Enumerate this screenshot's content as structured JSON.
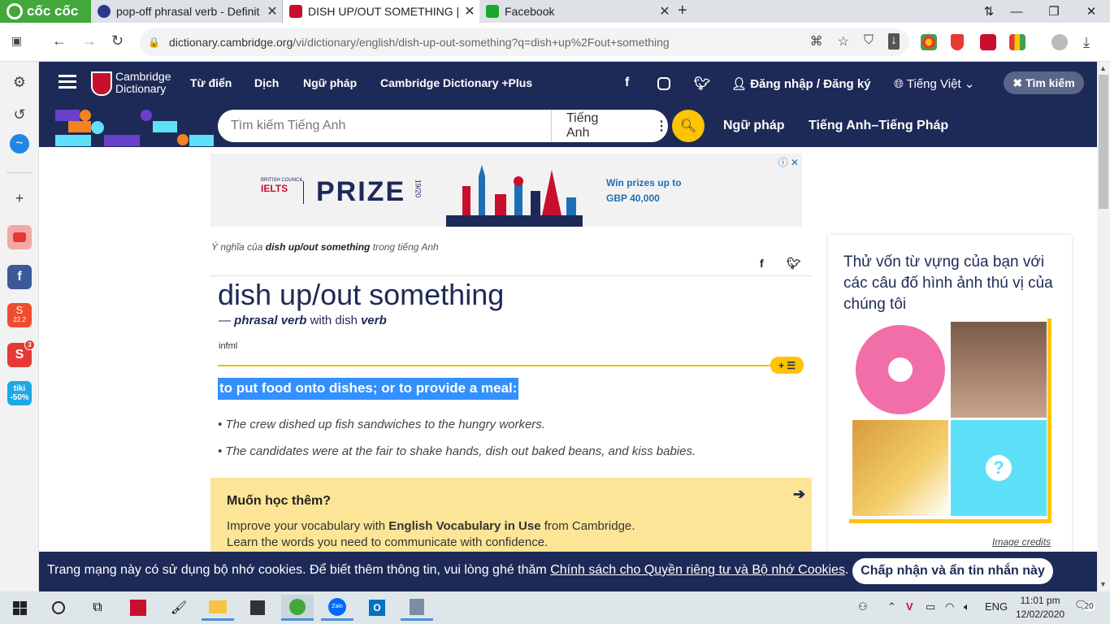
{
  "browser": {
    "brand": "cốc cốc",
    "tabs": [
      {
        "title": "pop-off phrasal verb - Definit",
        "favicon": "oxford-icon",
        "color": "#2b3a8c"
      },
      {
        "title": "DISH UP/OUT SOMETHING | n",
        "favicon": "cambridge-icon",
        "color": "#c8102e"
      },
      {
        "title": "Facebook",
        "favicon": "facebook-green-icon",
        "color": "#19a92e"
      }
    ],
    "close_glyph": "✕",
    "new_tab_glyph": "+",
    "url_host": "dictionary.cambridge.org",
    "url_path": "/vi/dictionary/english/dish-up-out-something?q=dish+up%2Fout+something"
  },
  "site": {
    "brand_line1": "Cambridge",
    "brand_line2": "Dictionary",
    "nav": [
      "Từ điển",
      "Dịch",
      "Ngữ pháp",
      "Cambridge Dictionary +Plus"
    ],
    "login": "Đăng nhập / Đăng ký",
    "language": "Tiếng Việt",
    "close_search": "Tìm kiếm",
    "search_placeholder": "Tìm kiếm Tiếng Anh",
    "search_lang": "Tiếng Anh",
    "bar_links": [
      "Ngữ pháp",
      "Tiếng Anh–Tiếng Pháp"
    ]
  },
  "ad": {
    "council": "BRITISH COUNCIL",
    "ielts": "IELTS",
    "prize": "PRIZE",
    "year": "19/20",
    "win_line1": "Win prizes up to",
    "win_line2": "GBP 40,000"
  },
  "entry": {
    "crumb_prefix": "Ý nghĩa của",
    "crumb_word": "dish up/out something",
    "crumb_suffix": "trong tiếng Anh",
    "headword": "dish up/out something",
    "dash": "—",
    "pos": "phrasal verb",
    "with_text": "with dish",
    "verb": "verb",
    "register": "infml",
    "definition": "to put food onto dishes; or to provide a meal:",
    "examples": [
      "The crew dished up fish sandwiches to the hungry workers.",
      "The candidates were at the fair to shake hands, dish out baked beans, and kiss babies."
    ]
  },
  "learn_more": {
    "title": "Muốn học thêm?",
    "line1_pre": "Improve your vocabulary with",
    "line1_bold": "English Vocabulary in Use",
    "line1_post": "from Cambridge.",
    "line2": "Learn the words you need to communicate with confidence."
  },
  "quiz": {
    "title": "Thử vốn từ vựng của bạn với các câu đố hình ảnh thú vị của chúng tôi",
    "credits": "Image credits"
  },
  "cookie": {
    "text": "Trang mạng này có sử dụng bộ nhớ cookies. Để biết thêm thông tin, vui lòng ghé thăm",
    "link": "Chính sách cho Quyền riêng tư và Bộ nhớ Cookies",
    "period": ".",
    "accept": "Chấp nhận và ẩn tin nhắn này"
  },
  "sidebar_badges": {
    "shopee": "22.2",
    "notif_count": "3",
    "tiki": "tiki",
    "tiki_discount": "-50%"
  },
  "taskbar": {
    "lang": "ENG",
    "time": "11:01 pm",
    "date": "12/02/2020",
    "notifications": "20"
  }
}
